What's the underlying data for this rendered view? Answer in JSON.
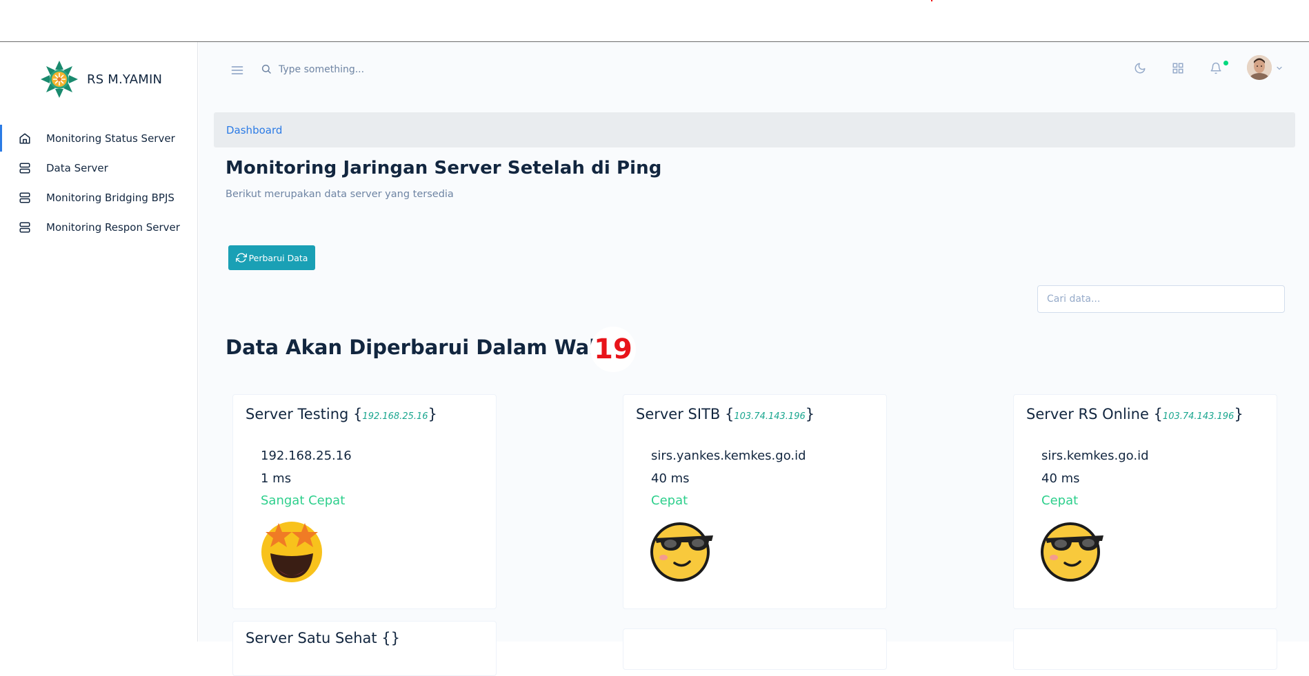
{
  "app": {
    "brand": "RS M.YAMIN"
  },
  "sidebar": {
    "items": [
      {
        "label": "Monitoring Status Server",
        "icon": "home-icon",
        "active": true
      },
      {
        "label": "Data Server",
        "icon": "server-icon"
      },
      {
        "label": "Monitoring Bridging BPJS",
        "icon": "server-icon"
      },
      {
        "label": "Monitoring Respon Server",
        "icon": "server-icon"
      }
    ]
  },
  "topbar": {
    "search_placeholder": "Type something...",
    "icons": [
      "menu-icon",
      "search-icon",
      "moon-icon",
      "grid-icon",
      "bell-icon",
      "avatar",
      "chevron-down-icon"
    ],
    "notif_color": "#00d97e"
  },
  "breadcrumb": {
    "label": "Dashboard"
  },
  "page": {
    "title": "Monitoring Jaringan Server Setelah di Ping",
    "subtitle": "Berikut merupakan data server yang tersedia",
    "refresh_label": "Perbarui Data",
    "data_search_placeholder": "Cari data...",
    "countdown_label": "Data Akan Diperbarui Dalam Waktu",
    "countdown_value": "19"
  },
  "servers": [
    {
      "name": "Server Testing",
      "ip": "192.168.25.16",
      "host": "192.168.25.16",
      "ms": "1 ms",
      "status": "Sangat Cepat",
      "emoji": "star-struck-emoji"
    },
    {
      "name": "Server SITB",
      "ip": "103.74.143.196",
      "host": "sirs.yankes.kemkes.go.id",
      "ms": "40 ms",
      "status": "Cepat",
      "emoji": "sunglasses-emoji"
    },
    {
      "name": "Server RS Online",
      "ip": "103.74.143.196",
      "host": "sirs.kemkes.go.id",
      "ms": "40 ms",
      "status": "Cepat",
      "emoji": "sunglasses-emoji"
    },
    {
      "name": "Server Satu Sehat",
      "ip": "",
      "host": "",
      "ms": "",
      "status": "",
      "emoji": ""
    }
  ],
  "colors": {
    "accent": "#2c7be5",
    "refresh_button": "#1aa0b5",
    "status_green": "#2dcf8c",
    "ip_green": "#1aa68f",
    "countdown_red": "#e8141a"
  }
}
